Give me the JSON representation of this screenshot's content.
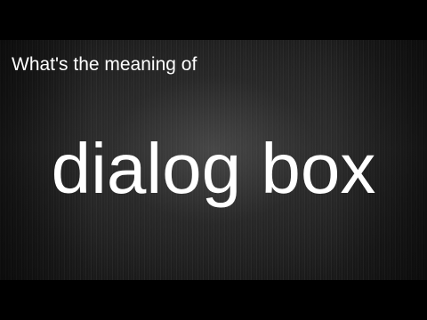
{
  "video": {
    "subtitle": "What's the meaning of",
    "headline": "dialog box"
  },
  "colors": {
    "text": "#ffffff",
    "letterbox": "#000000",
    "background": "#2a2a2a"
  }
}
